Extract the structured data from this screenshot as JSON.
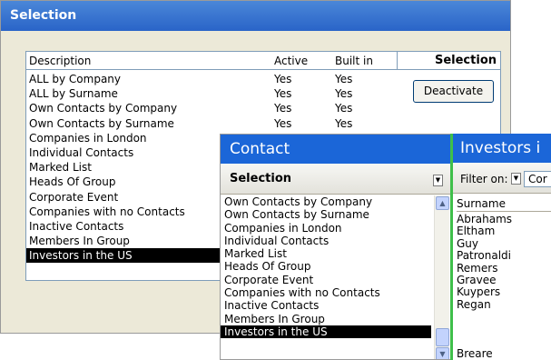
{
  "selection_window": {
    "title": "Selection",
    "headers": {
      "description": "Description",
      "active": "Active",
      "built_in": "Built in",
      "selection": "Selection"
    },
    "rows": [
      {
        "description": "ALL by Company",
        "active": "Yes",
        "built_in": "Yes"
      },
      {
        "description": "ALL by Surname",
        "active": "Yes",
        "built_in": "Yes"
      },
      {
        "description": "Own Contacts by Company",
        "active": "Yes",
        "built_in": "Yes"
      },
      {
        "description": "Own Contacts by Surname",
        "active": "Yes",
        "built_in": "Yes"
      },
      {
        "description": "Companies in London",
        "active": "",
        "built_in": ""
      },
      {
        "description": "Individual Contacts",
        "active": "",
        "built_in": ""
      },
      {
        "description": "Marked List",
        "active": "",
        "built_in": ""
      },
      {
        "description": "Heads Of Group",
        "active": "",
        "built_in": ""
      },
      {
        "description": "Corporate Event",
        "active": "",
        "built_in": ""
      },
      {
        "description": "Companies with no Contacts",
        "active": "",
        "built_in": ""
      },
      {
        "description": "Inactive Contacts",
        "active": "",
        "built_in": ""
      },
      {
        "description": "Members In Group",
        "active": "",
        "built_in": ""
      },
      {
        "description": "Investors in the US",
        "active": "",
        "built_in": ""
      }
    ],
    "deactivate_label": "Deactivate"
  },
  "contact_window": {
    "title": "Contact",
    "selection_label": "Selection",
    "items": [
      "Own Contacts by Company",
      "Own Contacts by Surname",
      "Companies in London",
      "Individual Contacts",
      "Marked List",
      "Heads Of Group",
      "Corporate Event",
      "Companies with no Contacts",
      "Inactive Contacts",
      "Members In Group",
      "Investors in the US"
    ]
  },
  "investors_window": {
    "title": "Investors i",
    "filter_label": "Filter on:",
    "filter_value": "Cor",
    "column_header": "Surname",
    "surnames": [
      "Abrahams",
      "Eltham",
      "Guy",
      "Patronaldi",
      "Remers",
      "Gravee",
      "Kuypers",
      "Regan"
    ],
    "last_surname": "Breare"
  }
}
